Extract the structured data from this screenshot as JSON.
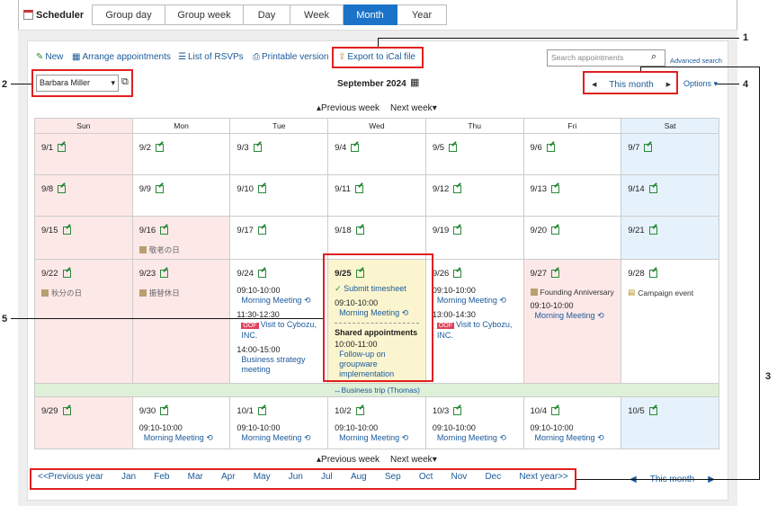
{
  "app_title": "Scheduler",
  "tabs": [
    "Group day",
    "Group week",
    "Day",
    "Week",
    "Month",
    "Year"
  ],
  "active_tab": "Month",
  "toolbar": {
    "new": "New",
    "arrange": "Arrange appointments",
    "rsvp": "List of RSVPs",
    "print": "Printable version",
    "ical": "Export to iCal file"
  },
  "search": {
    "placeholder": "Search appointments",
    "advanced": "Advanced search"
  },
  "user_select": "Barbara Miller",
  "month_title": "September 2024",
  "nav": {
    "this_month": "This month",
    "options": "Options"
  },
  "week_nav": {
    "prev": "Previous week",
    "next": "Next week"
  },
  "weekdays": [
    "Sun",
    "Mon",
    "Tue",
    "Wed",
    "Thu",
    "Fri",
    "Sat"
  ],
  "cells": {
    "r1": [
      "9/1",
      "9/2",
      "9/3",
      "9/4",
      "9/5",
      "9/6",
      "9/7"
    ],
    "r2": [
      "9/8",
      "9/9",
      "9/10",
      "9/11",
      "9/12",
      "9/13",
      "9/14"
    ],
    "r3": [
      "9/15",
      "9/16",
      "9/17",
      "9/18",
      "9/19",
      "9/20",
      "9/21"
    ],
    "r4": [
      "9/22",
      "9/23",
      "9/24",
      "9/25",
      "9/26",
      "9/27",
      "9/28"
    ],
    "r5": [
      "9/29",
      "9/30",
      "10/1",
      "10/2",
      "10/3",
      "10/4",
      "10/5"
    ]
  },
  "holidays": {
    "h916": "敬老の日",
    "h922": "秋分の日",
    "h923": "振替休日",
    "h927": "Founding Anniversary",
    "h928": "Campaign event"
  },
  "events": {
    "t1": "09:10-10:00",
    "mm": "Morning Meeting",
    "t2": "11:30-12:30",
    "oof": "OOF",
    "visit": "Visit to Cybozu, INC.",
    "t3": "14:00-15:00",
    "biz": "Business strategy meeting",
    "submit": "Submit timesheet",
    "shared": "Shared appointments",
    "t4": "10:00-11:00",
    "follow": "Follow-up on groupware implementation",
    "t5": "13:00-14:30",
    "trip": "Business trip (Thomas)"
  },
  "years": [
    "<<Previous year",
    "Jan",
    "Feb",
    "Mar",
    "Apr",
    "May",
    "Jun",
    "Jul",
    "Aug",
    "Sep",
    "Oct",
    "Nov",
    "Dec",
    "Next year>>"
  ],
  "callouts": [
    "1",
    "2",
    "3",
    "4",
    "5"
  ]
}
